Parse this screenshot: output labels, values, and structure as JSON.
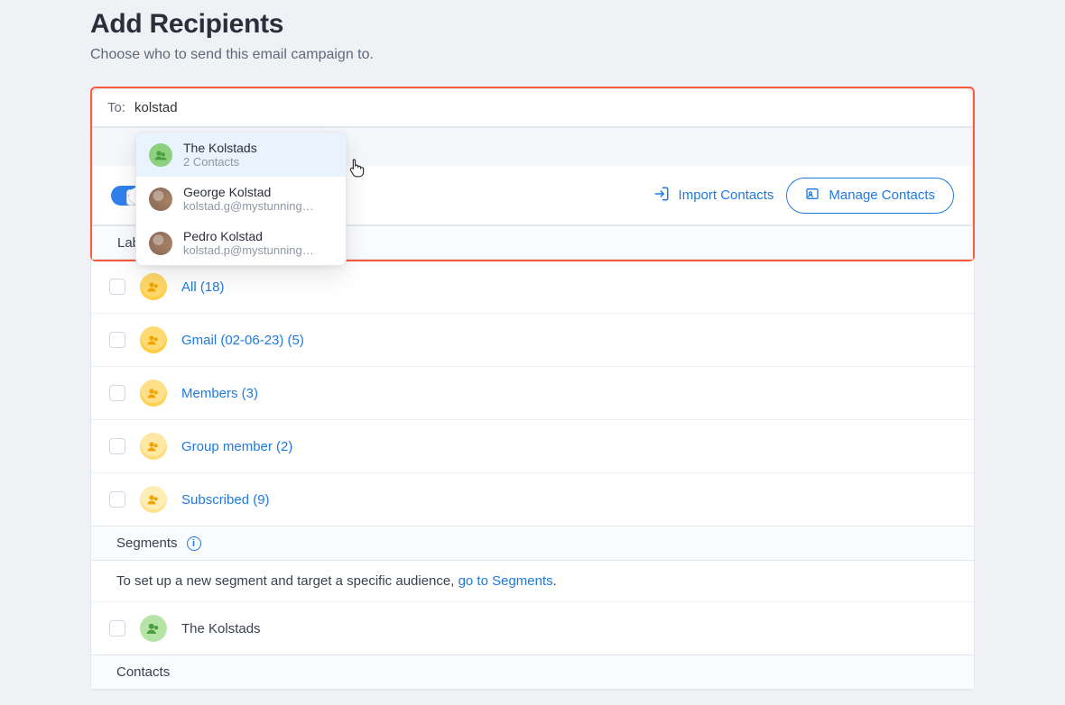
{
  "header": {
    "title": "Add Recipients",
    "subtitle": "Choose who to send this email campaign to."
  },
  "to": {
    "label": "To:",
    "value": "kolstad"
  },
  "autocomplete": [
    {
      "title": "The Kolstads",
      "subtitle": "2 Contacts",
      "type": "group",
      "hovered": true
    },
    {
      "title": "George Kolstad",
      "subtitle": "kolstad.g@mystunning…",
      "type": "person",
      "hovered": false
    },
    {
      "title": "Pedro Kolstad",
      "subtitle": "kolstad.p@mystunning…",
      "type": "person",
      "hovered": false
    }
  ],
  "toolbar": {
    "toggle_on": true,
    "import_label": "Import Contacts",
    "manage_label": "Manage Contacts"
  },
  "sections": {
    "labels_header": "Lab",
    "segments_header": "Segments",
    "contacts_header": "Contacts",
    "segments_note_prefix": "To set up a new segment and target a specific audience, ",
    "segments_note_link": "go to Segments",
    "segments_note_suffix": "."
  },
  "labels": [
    {
      "name": "All (18)"
    },
    {
      "name": "Gmail (02-06-23) (5)"
    },
    {
      "name": "Members (3)"
    },
    {
      "name": "Group member (2)"
    },
    {
      "name": "Subscribed (9)"
    }
  ],
  "segments_items": [
    {
      "name": "The Kolstads"
    }
  ]
}
